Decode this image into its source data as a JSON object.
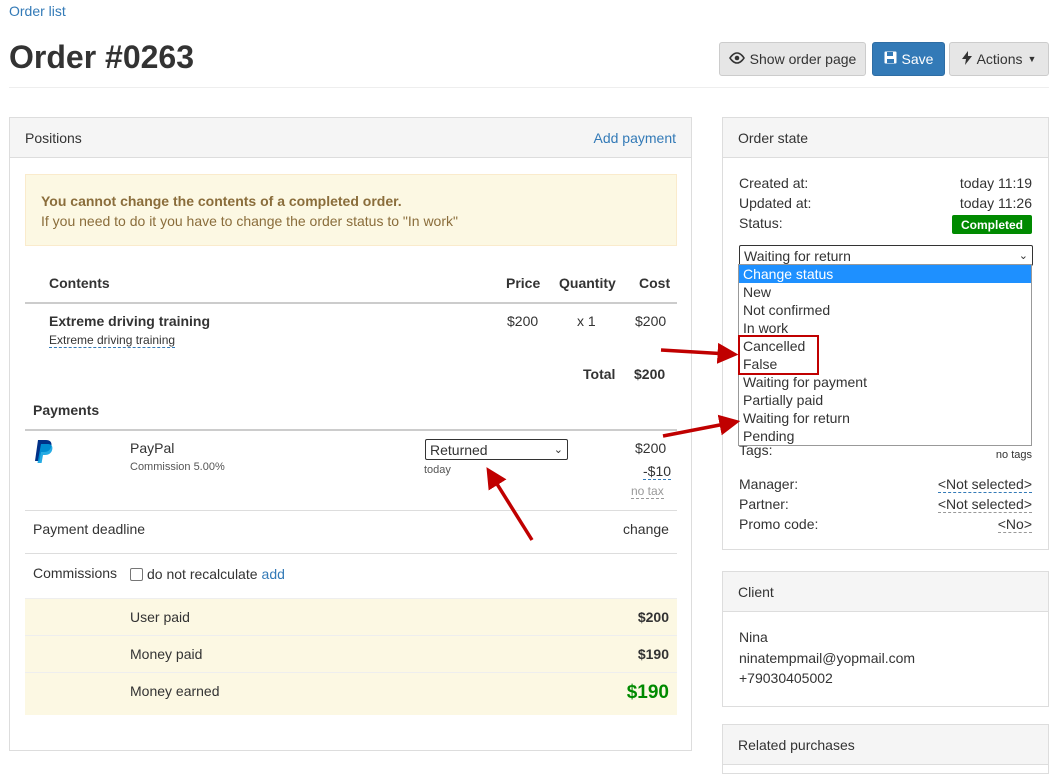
{
  "header": {
    "breadcrumb": "Order list",
    "title": "Order #0263",
    "show_order_page": "Show order page",
    "save": "Save",
    "actions": "Actions"
  },
  "positions": {
    "title": "Positions",
    "add_payment": "Add payment",
    "warning_title": "You cannot change the contents of a completed order.",
    "warning_text": "If you need to do it you have to change the order status to \"In work\"",
    "columns": {
      "contents": "Contents",
      "price": "Price",
      "quantity": "Quantity",
      "cost": "Cost"
    },
    "item": {
      "name": "Extreme driving training",
      "sub": "Extreme driving training",
      "price": "$200",
      "quantity": "x 1",
      "cost": "$200"
    },
    "total_label": "Total",
    "total_value": "$200"
  },
  "payments": {
    "title": "Payments",
    "method": "PayPal",
    "commission": "Commission 5.00%",
    "status_value": "Returned",
    "date": "today",
    "amount": "$200",
    "fee": "-$10",
    "tax": "no tax",
    "deadline_label": "Payment deadline",
    "deadline_action": "change",
    "commissions_label": "Commissions",
    "no_recalc": "do not recalculate",
    "add": "add",
    "user_paid_label": "User paid",
    "user_paid_value": "$200",
    "money_paid_label": "Money paid",
    "money_paid_value": "$190",
    "money_earned_label": "Money earned",
    "money_earned_value": "$190"
  },
  "order_state": {
    "title": "Order state",
    "created_label": "Created at:",
    "created_value": "today 11:19",
    "updated_label": "Updated at:",
    "updated_value": "today 11:26",
    "status_label": "Status:",
    "status_badge": "Completed",
    "status_select": "Waiting for return",
    "options": [
      "Change status",
      "New",
      "Not confirmed",
      "In work",
      "Cancelled",
      "False",
      "Waiting for payment",
      "Partially paid",
      "Waiting for return",
      "Pending"
    ],
    "tags_label": "Tags:",
    "tags_value": "no tags",
    "manager_label": "Manager:",
    "manager_value": "<Not selected>",
    "partner_label": "Partner:",
    "partner_value": "<Not selected>",
    "promo_label": "Promo code:",
    "promo_value": "<No>"
  },
  "client": {
    "title": "Client",
    "name": "Nina",
    "email": "ninatempmail@yopmail.com",
    "phone": "+79030405002"
  },
  "related": {
    "title": "Related purchases"
  },
  "colors": {
    "accent": "#337ab7",
    "success": "#008a00",
    "warning_bg": "#fcf8e3",
    "annotation": "#c00000"
  }
}
